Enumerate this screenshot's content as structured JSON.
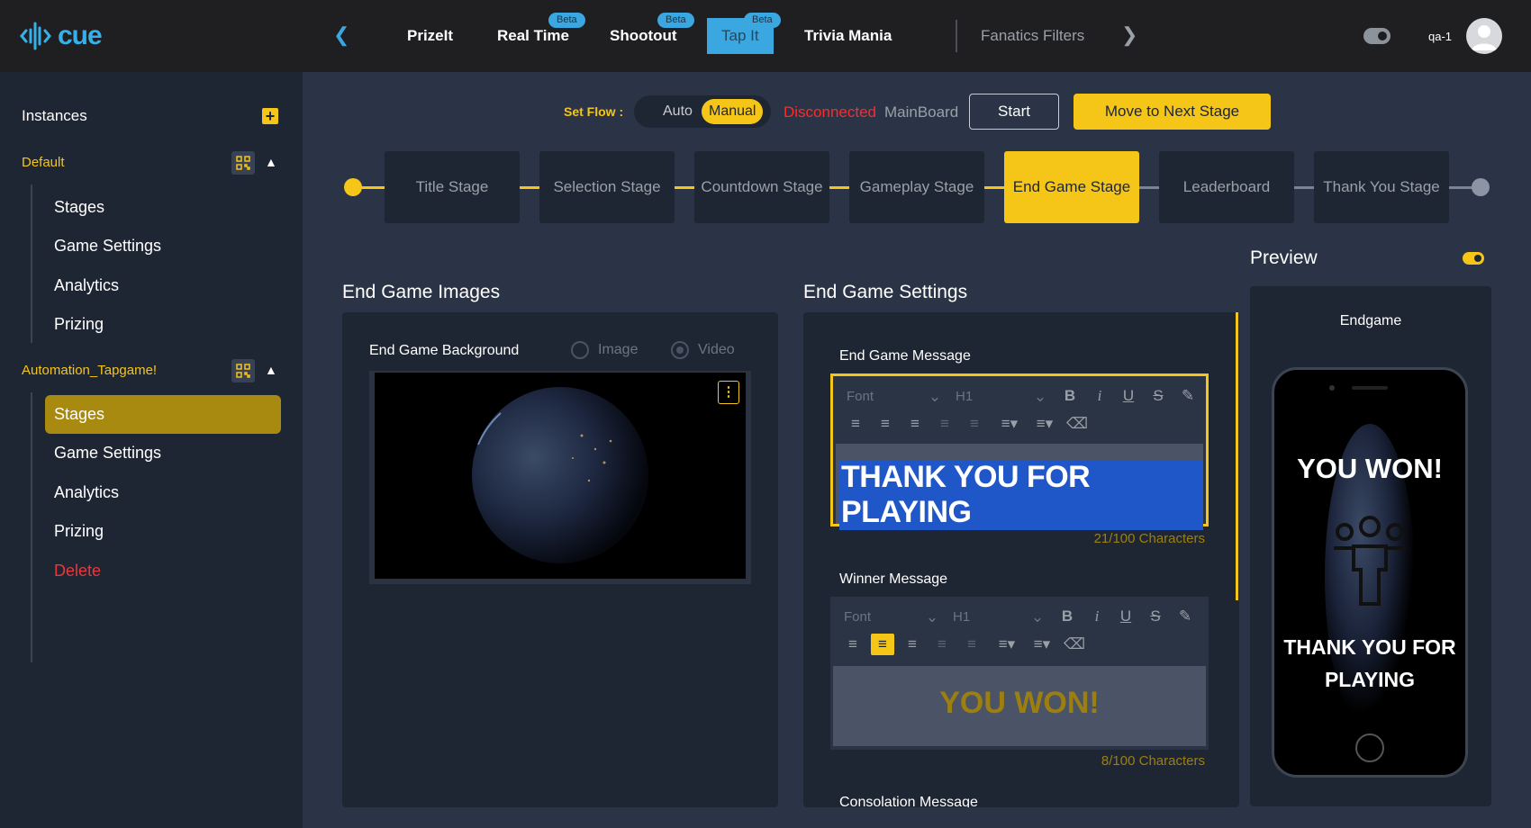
{
  "app": {
    "logo_text": "cue",
    "username": "qa-1"
  },
  "games": {
    "tabs": [
      {
        "label": "PrizeIt"
      },
      {
        "label": "Real Time",
        "badge": "Beta"
      },
      {
        "label": "Shootout",
        "badge": "Beta"
      },
      {
        "label": "Tap It",
        "badge": "Beta",
        "active": true
      },
      {
        "label": "Trivia Mania"
      }
    ],
    "secondary": "Fanatics Filters"
  },
  "sidebar": {
    "title": "Instances",
    "instances": [
      {
        "name": "Default",
        "items": [
          "Stages",
          "Game Settings",
          "Analytics",
          "Prizing"
        ]
      },
      {
        "name": "Automation_Tapgame!",
        "items": [
          "Stages",
          "Game Settings",
          "Analytics",
          "Prizing",
          "Delete"
        ],
        "active_item": "Stages"
      }
    ]
  },
  "flow": {
    "label": "Set Flow :",
    "options": [
      "Auto",
      "Manual"
    ],
    "selected": "Manual",
    "status": "Disconnected",
    "board": "MainBoard",
    "start_label": "Start",
    "next_label": "Move to Next Stage"
  },
  "stages": {
    "items": [
      "Title Stage",
      "Selection Stage",
      "Countdown Stage",
      "Gameplay Stage",
      "End Game Stage",
      "Leaderboard",
      "Thank You Stage"
    ],
    "active": "End Game Stage"
  },
  "images": {
    "title": "End Game Images",
    "background_label": "End Game Background",
    "type_options": [
      "Image",
      "Video"
    ],
    "selected_type": "Video"
  },
  "settings": {
    "title": "End Game Settings",
    "end_message": {
      "label": "End Game Message",
      "font": "Font",
      "size": "H1",
      "value": "THANK YOU FOR PLAYING",
      "counter": "21/100 Characters"
    },
    "winner_message": {
      "label": "Winner Message",
      "font": "Font",
      "size": "H1",
      "value": "YOU WON!",
      "counter": "8/100 Characters"
    },
    "consolation_label": "Consolation Message"
  },
  "preview": {
    "title": "Preview",
    "screen_label": "Endgame",
    "headline": "YOU WON!",
    "footer": "THANK YOU FOR PLAYING"
  },
  "colors": {
    "accent": "#f5c518",
    "danger": "#ff2a2a",
    "info": "#3aa7e0",
    "page_bg": "#2a3446",
    "panel_bg": "#1f2633"
  }
}
